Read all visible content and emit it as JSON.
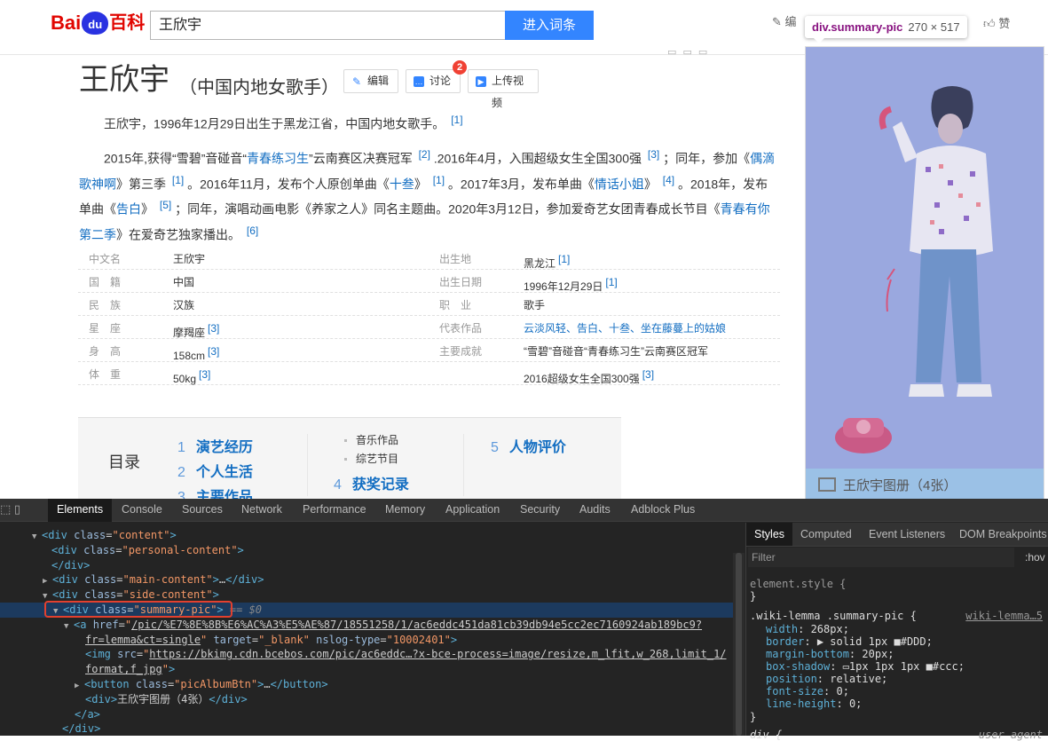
{
  "header": {
    "logo": {
      "part1": "Bai",
      "paw": "du",
      "part2": "百科"
    },
    "search_value": "王欣宇",
    "search_button": "进入词条",
    "edit_label": "编",
    "like_label": "赞"
  },
  "tooltip": {
    "selector": "div.summary-pic",
    "size": "270 × 517"
  },
  "article": {
    "title": "王欣宇",
    "subtitle": "（中国内地女歌手）",
    "buttons": {
      "edit": "编辑",
      "discuss": "讨论",
      "upload_video": "上传视频"
    },
    "discuss_badge": "2",
    "para1": {
      "text": "王欣宇，1996年12月29日出生于黑龙江省，中国内地女歌手。",
      "ref": "[1]"
    },
    "para2": [
      {
        "t": "2015年,获得“雪碧”音碰音“"
      },
      {
        "l": "青春练习生"
      },
      {
        "t": "”云南赛区决赛冠军 "
      },
      {
        "r": "[2]"
      },
      {
        "t": " .2016年4月，入围超级女生全国300强 "
      },
      {
        "r": "[3]"
      },
      {
        "t": " ；同年，参加《"
      },
      {
        "l": "偶滴歌神啊"
      },
      {
        "t": "》第三季 "
      },
      {
        "r": "[1]"
      },
      {
        "t": " 。2016年11月，发布个人原创单曲《"
      },
      {
        "l": "十叁"
      },
      {
        "t": "》 "
      },
      {
        "r": "[1]"
      },
      {
        "t": " 。2017年3月，发布单曲《"
      },
      {
        "l": "情话小姐"
      },
      {
        "t": "》 "
      },
      {
        "r": "[4]"
      },
      {
        "t": " 。2018年，发布单曲《"
      },
      {
        "l": "告白"
      },
      {
        "t": "》 "
      },
      {
        "r": "[5]"
      },
      {
        "t": " ；同年，演唱动画电影《养家之人》同名主题曲。2020年3月12日，参加爱奇艺女团青春成长节目《"
      },
      {
        "l": "青春有你第二季"
      },
      {
        "t": "》在爱奇艺独家播出。 "
      },
      {
        "r": "[6]"
      }
    ]
  },
  "infobox": {
    "rows": [
      {
        "k1": "中文名",
        "v1": "王欣宇",
        "r1": "",
        "k2": "出生地",
        "v2": "黑龙江",
        "r2": "[1]"
      },
      {
        "k1": "国　籍",
        "v1": "中国",
        "r1": "",
        "k2": "出生日期",
        "v2": "1996年12月29日",
        "r2": "[1]"
      },
      {
        "k1": "民　族",
        "v1": "汉族",
        "r1": "",
        "k2": "职　业",
        "v2": "歌手",
        "r2": ""
      },
      {
        "k1": "星　座",
        "v1": "摩羯座",
        "r1": "[3]",
        "k2": "代表作品",
        "v2": "云淡风轻、告白、十叁、坐在藤蔓上的姑娘",
        "r2": ""
      },
      {
        "k1": "身　高",
        "v1": "158cm",
        "r1": "[3]",
        "k2": "主要成就",
        "v2": "“雪碧”音碰音“青春练习生”云南赛区冠军",
        "r2": ""
      },
      {
        "k1": "体　重",
        "v1": "50kg",
        "r1": "[3]",
        "k2": "",
        "v2": "2016超级女生全国300强",
        "r2": "[3]"
      }
    ]
  },
  "toc": {
    "title": "目录",
    "items": [
      {
        "num": "1",
        "label": "演艺经历"
      },
      {
        "num": "2",
        "label": "个人生活"
      },
      {
        "num": "3",
        "label": "主要作品"
      },
      {
        "num": "4",
        "label": "获奖记录"
      },
      {
        "num": "5",
        "label": "人物评价"
      }
    ],
    "subs": [
      "音乐作品",
      "综艺节目"
    ]
  },
  "side": {
    "album_label": "王欣宇图册（4张）"
  },
  "devtools": {
    "tabs": [
      "Elements",
      "Console",
      "Sources",
      "Network",
      "Performance",
      "Memory",
      "Application",
      "Security",
      "Audits",
      "Adblock Plus"
    ],
    "active_tab": "Elements",
    "dom_lines": [
      {
        "html": "<span class='tri'>▼</span><span class='tag'>&lt;div</span> <span class='at'>class</span>=<span class='av'>\"content\"</span><span class='tag'>&gt;</span>"
      },
      {
        "html": "<span class='tag'>&lt;div</span> <span class='at'>class</span>=<span class='av'>\"personal-content\"</span><span class='tag'>&gt;</span>"
      },
      {
        "html": "<span class='tag'>&lt;/div&gt;</span>"
      },
      {
        "html": "<span class='tri'>▶</span><span class='tag'>&lt;div</span> <span class='at'>class</span>=<span class='av'>\"main-content\"</span><span class='tag'>&gt;</span><span class='tx'>…</span><span class='tag'>&lt;/div&gt;</span>"
      },
      {
        "html": "<span class='tri'>▼</span><span class='tag'>&lt;div</span> <span class='at'>class</span>=<span class='av'>\"side-content\"</span><span class='tag'>&gt;</span>"
      },
      {
        "html": "<span class='tri'>▼</span><span class='tag'>&lt;div</span> <span class='at'>class</span>=<span class='av'>\"summary-pic\"</span><span class='tag'>&gt;</span> <span class='eq'>== $0</span>"
      },
      {
        "html": "<span class='tri'>▼</span><span class='tag'>&lt;a</span> <span class='at'>href</span>=<span class='av'>\"<span class='lnk'>/pic/%E7%8E%8B%E6%AC%A3%E5%AE%87/18551258/1/ac6eddc451da81cb39db94e5cc2ec7160924ab189bc9?</span></span>"
      },
      {
        "html": "<span class='av'><span class='lnk'>fr=lemma&amp;ct=single</span>\"</span> <span class='at'>target</span>=<span class='av'>\"_blank\"</span> <span class='at'>nslog-type</span>=<span class='av'>\"10002401\"</span><span class='tag'>&gt;</span>"
      },
      {
        "html": "<span class='tag'>&lt;img</span> <span class='at'>src</span>=<span class='av'>\"<span class='lnk'>https://bkimg.cdn.bcebos.com/pic/ac6eddc…?x-bce-process=image/resize,m_lfit,w_268,limit_1/</span></span>"
      },
      {
        "html": "<span class='av'><span class='lnk'>format,f_jpg</span>\"</span><span class='tag'>&gt;</span>"
      },
      {
        "html": "<span class='tri'>▶</span><span class='tag'>&lt;button</span> <span class='at'>class</span>=<span class='av'>\"picAlbumBtn\"</span><span class='tag'>&gt;</span><span class='tx'>…</span><span class='tag'>&lt;/button&gt;</span>"
      },
      {
        "html": "<span class='tag'>&lt;div&gt;</span><span class='tx'>王欣宇图册（4张）</span><span class='tag'>&lt;/div&gt;</span>"
      },
      {
        "html": "<span class='tag'>&lt;/a&gt;</span>"
      },
      {
        "html": "<span class='tag'>&lt;/div&gt;</span>"
      }
    ],
    "styles_tabs": [
      "Styles",
      "Computed",
      "Event Listeners",
      "DOM Breakpoints"
    ],
    "filter_placeholder": "Filter",
    "hov": ":hov",
    "element_style": "element.style {",
    "close_brace": "}",
    "rule_selector": ".wiki-lemma .summary-pic {",
    "rule_source": "wiki-lemma…5",
    "props": [
      {
        "n": "width",
        "v": "268px;"
      },
      {
        "n": "border",
        "v": "▶ solid 1px ■#DDD;"
      },
      {
        "n": "margin-bottom",
        "v": "20px;"
      },
      {
        "n": "box-shadow",
        "v": "▭1px 1px 1px ■#ccc;"
      },
      {
        "n": "position",
        "v": "relative;"
      },
      {
        "n": "font-size",
        "v": "0;"
      },
      {
        "n": "line-height",
        "v": "0;"
      }
    ],
    "next_selector": "div {",
    "next_source": "user agent"
  }
}
